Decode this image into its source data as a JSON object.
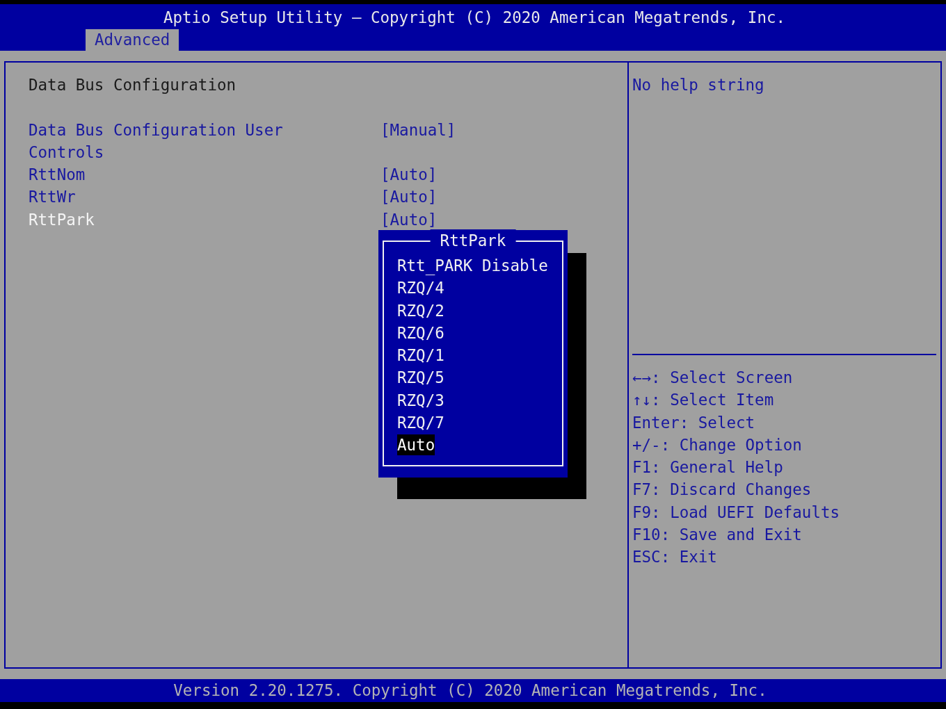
{
  "header": {
    "title": "Aptio Setup Utility – Copyright (C) 2020 American Megatrends, Inc.",
    "tabs": [
      {
        "label": "Advanced",
        "selected": true
      }
    ]
  },
  "menu": {
    "heading": "Data Bus Configuration",
    "items": [
      {
        "label": "Data Bus Configuration User Controls",
        "value": "[Manual]",
        "selected": false
      },
      {
        "label": "RttNom",
        "value": "[Auto]",
        "selected": false
      },
      {
        "label": "RttWr",
        "value": "[Auto]",
        "selected": false
      },
      {
        "label": "RttPark",
        "value": "[Auto]",
        "selected": true
      }
    ]
  },
  "help": {
    "text": "No help string",
    "keys": [
      "←→: Select Screen",
      "↑↓: Select Item",
      "Enter: Select",
      "+/-: Change Option",
      "F1: General Help",
      "F7: Discard Changes",
      "F9: Load UEFI Defaults",
      "F10: Save and Exit",
      "ESC: Exit"
    ]
  },
  "popup": {
    "title": "RttPark",
    "options": [
      {
        "label": "Rtt_PARK Disable",
        "selected": false
      },
      {
        "label": "RZQ/4",
        "selected": false
      },
      {
        "label": "RZQ/2",
        "selected": false
      },
      {
        "label": "RZQ/6",
        "selected": false
      },
      {
        "label": "RZQ/1",
        "selected": false
      },
      {
        "label": "RZQ/5",
        "selected": false
      },
      {
        "label": "RZQ/3",
        "selected": false
      },
      {
        "label": "RZQ/7",
        "selected": false
      },
      {
        "label": "Auto",
        "selected": true
      }
    ]
  },
  "footer": {
    "text": "Version 2.20.1275. Copyright (C) 2020 American Megatrends, Inc."
  }
}
